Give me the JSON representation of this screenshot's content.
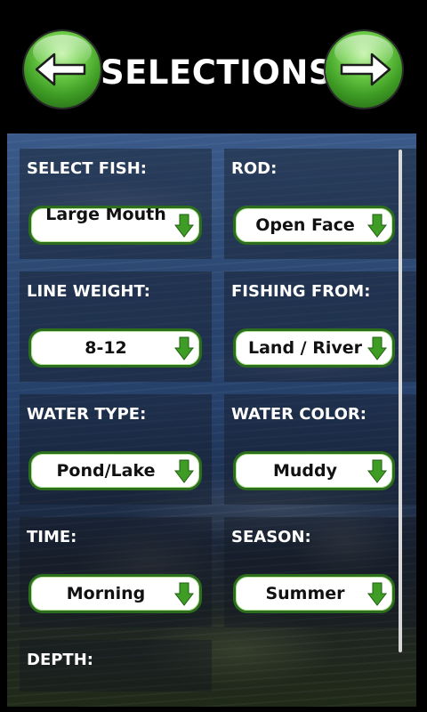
{
  "header": {
    "title": "SELECTIONS",
    "back_icon": "left-arrow-icon",
    "forward_icon": "right-arrow-icon"
  },
  "colors": {
    "dropdown_border": "#2d6e1c",
    "arrow_green": "#3f9d25",
    "label_text": "#ffffff"
  },
  "fields": [
    {
      "label": "SELECT FISH:",
      "value": "Large Mouth"
    },
    {
      "label": "ROD:",
      "value": "Open Face"
    },
    {
      "label": "LINE WEIGHT:",
      "value": "8-12"
    },
    {
      "label": "FISHING FROM:",
      "value": "Land / River"
    },
    {
      "label": "WATER TYPE:",
      "value": "Pond/Lake"
    },
    {
      "label": "WATER COLOR:",
      "value": "Muddy"
    },
    {
      "label": "TIME:",
      "value": "Morning"
    },
    {
      "label": "SEASON:",
      "value": "Summer"
    },
    {
      "label": "DEPTH:"
    }
  ]
}
